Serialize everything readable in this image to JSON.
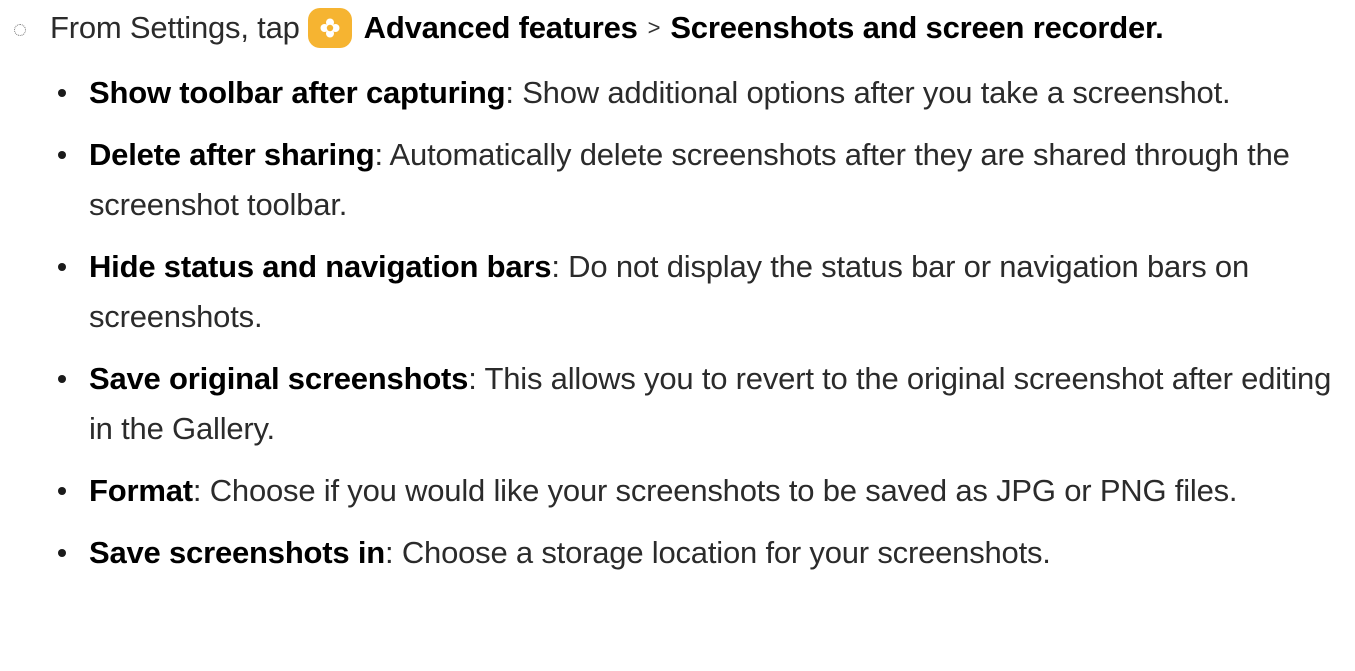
{
  "step": {
    "prefix": "From Settings, tap",
    "path_1": "Advanced features",
    "separator": ">",
    "path_2": "Screenshots and screen recorder."
  },
  "items": [
    {
      "term": "Show toolbar after capturing",
      "desc": " Show additional options after you take a screenshot."
    },
    {
      "term": "Delete after sharing",
      "desc": " Automatically delete screenshots after they are shared through the screenshot toolbar."
    },
    {
      "term": "Hide status and navigation bars",
      "desc": " Do not display the status bar or navigation bars on screenshots."
    },
    {
      "term": "Save original screenshots",
      "desc": " This allows you to revert to the original screenshot after editing in the Gallery."
    },
    {
      "term": "Format",
      "desc": " Choose if you would like your screenshots to be saved as JPG or PNG files."
    },
    {
      "term": "Save screenshots in",
      "desc": " Choose a storage location for your screenshots."
    }
  ],
  "colors": {
    "settings_icon_bg": "#f6b431",
    "text": "#2b2b2b"
  },
  "icons": {
    "step_marker": "dotted-circle-icon",
    "settings": "advanced-features-icon"
  }
}
